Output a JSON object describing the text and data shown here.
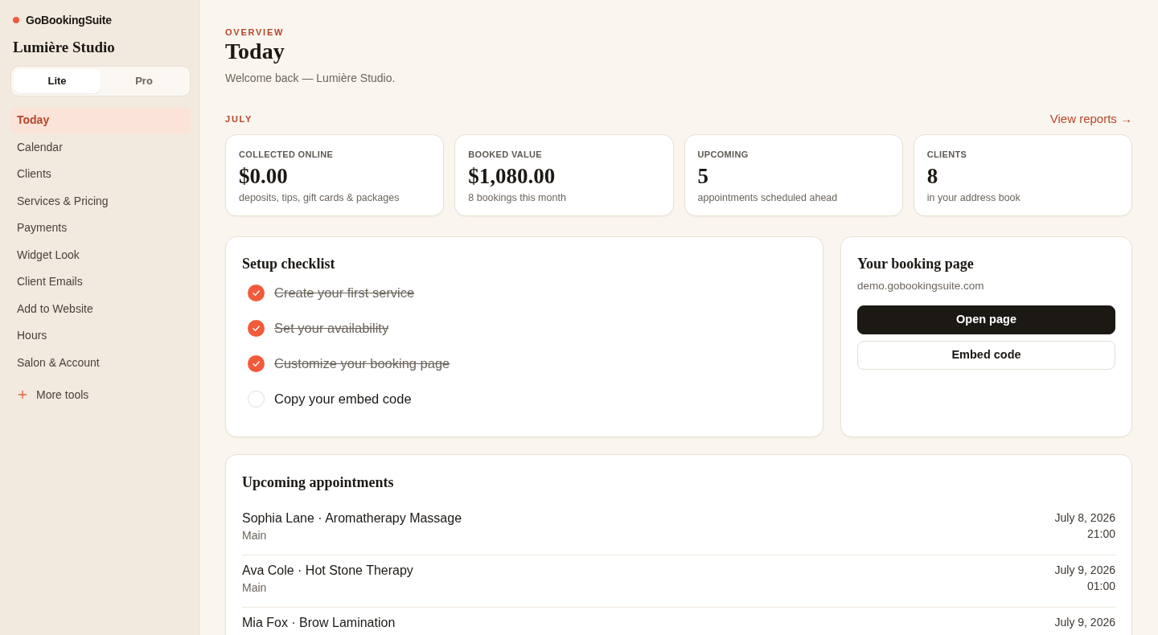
{
  "sidebar": {
    "brand": "GoBookingSuite",
    "workspace": "Lumière Studio",
    "plan_tabs": [
      {
        "label": "Lite",
        "selected": true
      },
      {
        "label": "Pro",
        "selected": false
      }
    ],
    "items": [
      {
        "label": "Today",
        "selected": true
      },
      {
        "label": "Calendar",
        "selected": false
      },
      {
        "label": "Clients",
        "selected": false
      },
      {
        "label": "Services & Pricing",
        "selected": false
      },
      {
        "label": "Payments",
        "selected": false
      },
      {
        "label": "Widget Look",
        "selected": false
      },
      {
        "label": "Client Emails",
        "selected": false
      },
      {
        "label": "Add to Website",
        "selected": false
      },
      {
        "label": "Hours",
        "selected": false
      },
      {
        "label": "Salon & Account",
        "selected": false
      }
    ],
    "more_tools": "More tools"
  },
  "header": {
    "eyebrow": "OVERVIEW",
    "title": "Today",
    "subtitle": "Welcome back — Lumière Studio."
  },
  "period": {
    "label": "JULY",
    "link": "View reports →"
  },
  "stats": [
    {
      "label": "COLLECTED ONLINE",
      "value": "$0.00",
      "caption": "deposits, tips, gift cards & packages"
    },
    {
      "label": "BOOKED VALUE",
      "value": "$1,080.00",
      "caption": "8 bookings this month"
    },
    {
      "label": "UPCOMING",
      "value": "5",
      "caption": "appointments scheduled ahead"
    },
    {
      "label": "CLIENTS",
      "value": "8",
      "caption": "in your address book"
    }
  ],
  "checklist": {
    "title": "Setup checklist",
    "items": [
      {
        "label": "Create your first service",
        "checked": true
      },
      {
        "label": "Set your availability",
        "checked": true
      },
      {
        "label": "Customize your booking page",
        "checked": true
      },
      {
        "label": "Copy your embed code",
        "checked": false
      }
    ]
  },
  "booking_page": {
    "title": "Your booking page",
    "url": "demo.gobookingsuite.com",
    "buttons": [
      {
        "label": "Open page",
        "kind": "primary"
      },
      {
        "label": "Embed code",
        "kind": "outline"
      }
    ]
  },
  "appointments": {
    "title": "Upcoming appointments",
    "rows": [
      {
        "title": "Sophia Lane · Aromatherapy Massage",
        "location": "Main",
        "date": "July 8, 2026",
        "time": "21:00"
      },
      {
        "title": "Ava Cole · Hot Stone Therapy",
        "location": "Main",
        "date": "July 9, 2026",
        "time": "01:00"
      },
      {
        "title": "Mia Fox · Brow Lamination",
        "date": "July 9, 2026"
      }
    ]
  }
}
